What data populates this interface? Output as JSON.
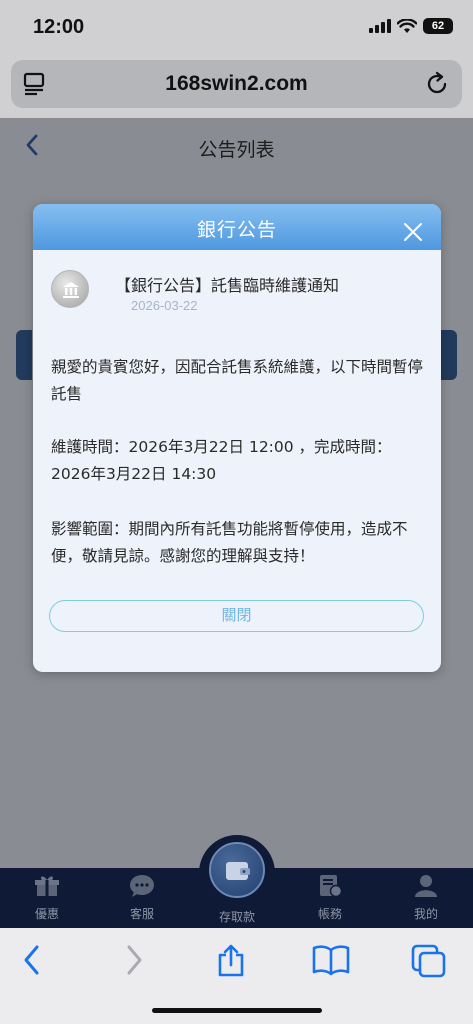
{
  "status_bar": {
    "time": "12:00",
    "battery": "62"
  },
  "browser": {
    "url": "168swin2.com"
  },
  "page": {
    "title": "公告列表"
  },
  "modal": {
    "title": "銀行公告",
    "notice_title": "【銀行公告】託售臨時維護通知",
    "notice_date": "2026-03-22",
    "paragraph_1": "親愛的貴賓您好，因配合託售系統維護，以下時間暫停託售",
    "paragraph_2": "維護時間：2026年3月22日 12:00 ，完成時間：2026年3月22日 14:30",
    "paragraph_3": "影響範圍：期間內所有託售功能將暫停使用，造成不便，敬請見諒。感謝您的理解與支持！",
    "close_button_label": "關閉"
  },
  "tabbar": {
    "tabs": [
      {
        "label": "優惠",
        "icon": "gift-icon"
      },
      {
        "label": "客服",
        "icon": "chat-icon"
      },
      {
        "label": "存取款",
        "icon": "wallet-icon"
      },
      {
        "label": "帳務",
        "icon": "ledger-icon"
      },
      {
        "label": "我的",
        "icon": "person-icon"
      }
    ]
  },
  "safari_toolbar": {
    "icons": [
      "back-icon",
      "forward-icon",
      "share-icon",
      "bookmarks-icon",
      "tabs-icon"
    ],
    "accent_color": "#1a73e8"
  }
}
